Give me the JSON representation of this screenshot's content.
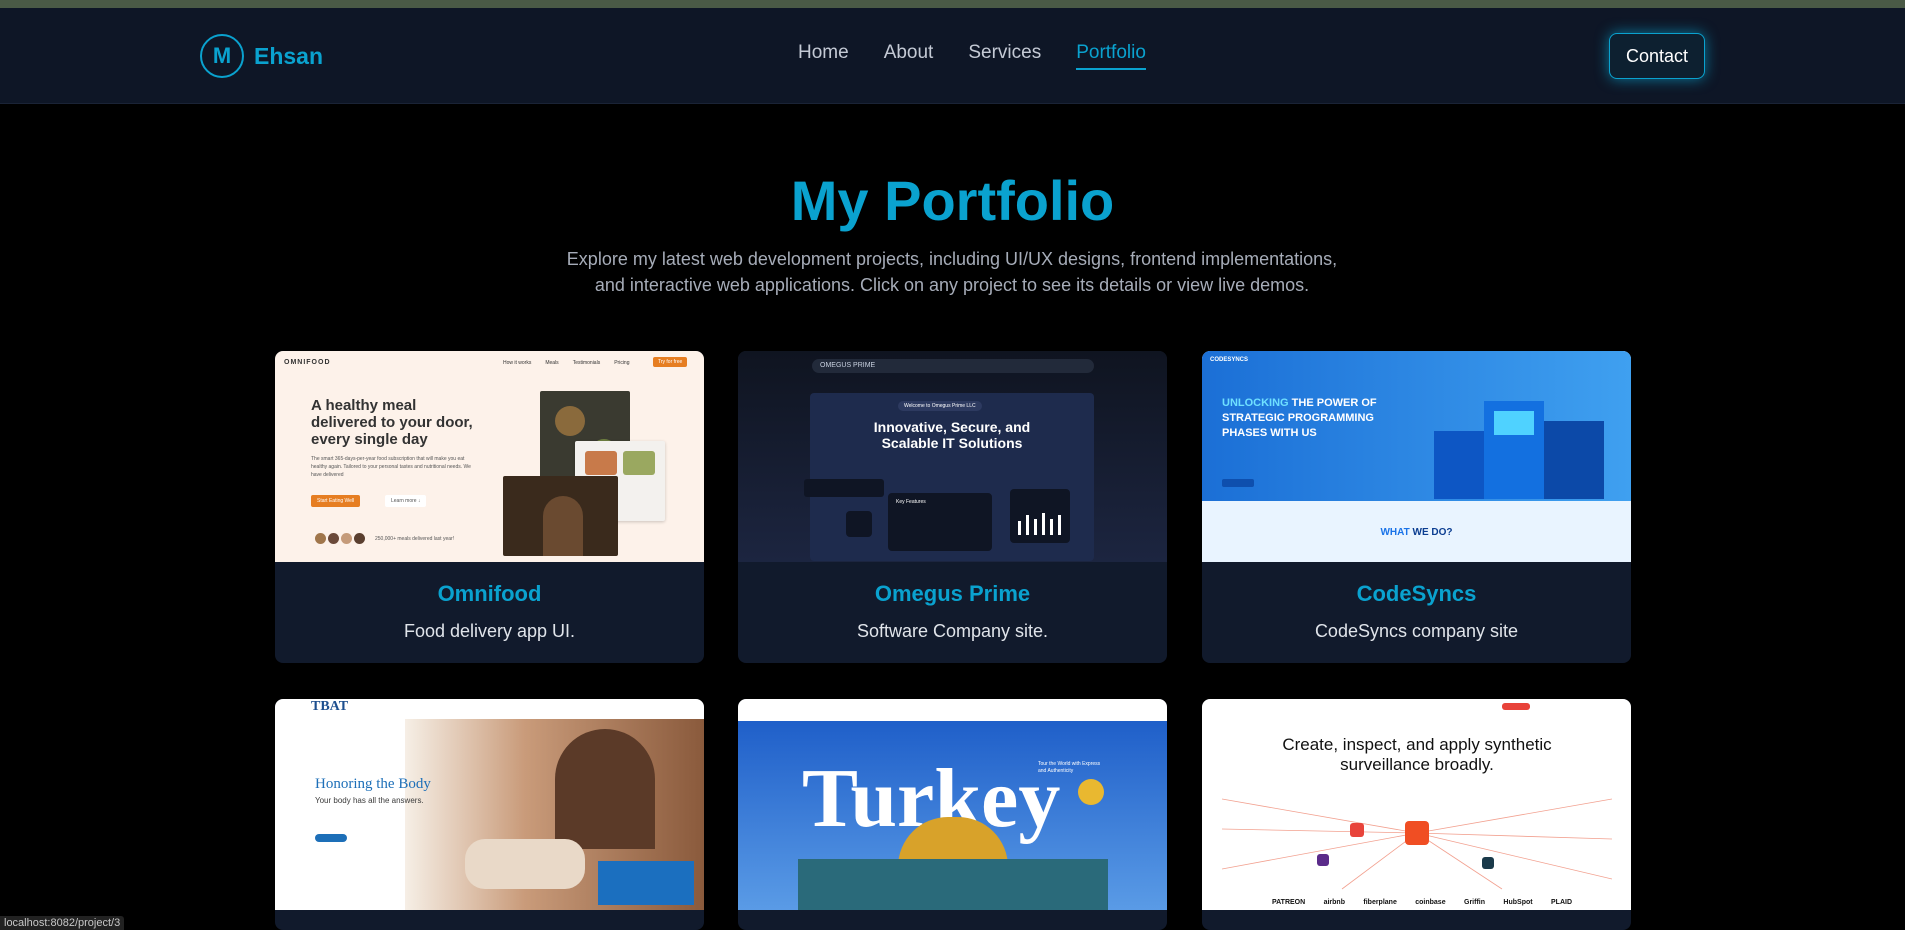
{
  "brand": {
    "badge": "M",
    "name": "Ehsan"
  },
  "nav": {
    "items": [
      "Home",
      "About",
      "Services",
      "Portfolio"
    ],
    "active": "Portfolio",
    "contact": "Contact"
  },
  "hero": {
    "title": "My Portfolio",
    "description": "Explore my latest web development projects, including UI/UX designs, frontend implementations, and interactive web applications. Click on any project to see its details or view live demos."
  },
  "projects": [
    {
      "title": "Omnifood",
      "description": "Food delivery app UI.",
      "thumb": {
        "logo": "OMNIFOOD",
        "links": [
          "How it works",
          "Meals",
          "Testimonials",
          "Pricing"
        ],
        "cta": "Try for free",
        "headline": "A healthy meal delivered to your door, every single day",
        "body": "The smart 365-days-per-year food subscription that will make you eat healthy again. Tailored to your personal tastes and nutritional needs. We have delivered",
        "btn1": "Start Eating Well",
        "btn2": "Learn more ↓",
        "footnote": "250,000+ meals delivered last year!"
      }
    },
    {
      "title": "Omegus Prime",
      "description": "Software Company site.",
      "thumb": {
        "logo": "OMEGUS PRIME",
        "pill": "Welcome to Omegus Prime LLC",
        "headline": "Innovative, Secure, and Scalable IT Solutions",
        "features": "Key Features"
      }
    },
    {
      "title": "CodeSyncs",
      "description": "CodeSyncs company site",
      "thumb": {
        "logo": "CODESYNCS",
        "headline_accent": "UNLOCKING",
        "headline": "THE POWER OF STRATEGIC PROGRAMMING PHASES WITH US",
        "section_accent": "WHAT",
        "section": "WE DO?"
      }
    },
    {
      "title": "",
      "description": "",
      "thumb": {
        "logo": "TBAT",
        "headline": "Honoring the Body",
        "sub": "Your body has all the answers."
      }
    },
    {
      "title": "",
      "description": "",
      "thumb": {
        "headline": "Turkey",
        "sub": "Tour the World with Express and Authenticity"
      }
    },
    {
      "title": "",
      "description": "",
      "thumb": {
        "headline": "Create, inspect, and apply synthetic surveillance broadly.",
        "brands": [
          "PATREON",
          "airbnb",
          "fiberplane",
          "coinbase",
          "Griffin",
          "HubSpot",
          "PLAID"
        ]
      }
    }
  ],
  "status_url": "localhost:8082/project/3",
  "colors": {
    "accent": "#0aa2cf",
    "card": "#111a2c",
    "header": "#0e1626"
  }
}
